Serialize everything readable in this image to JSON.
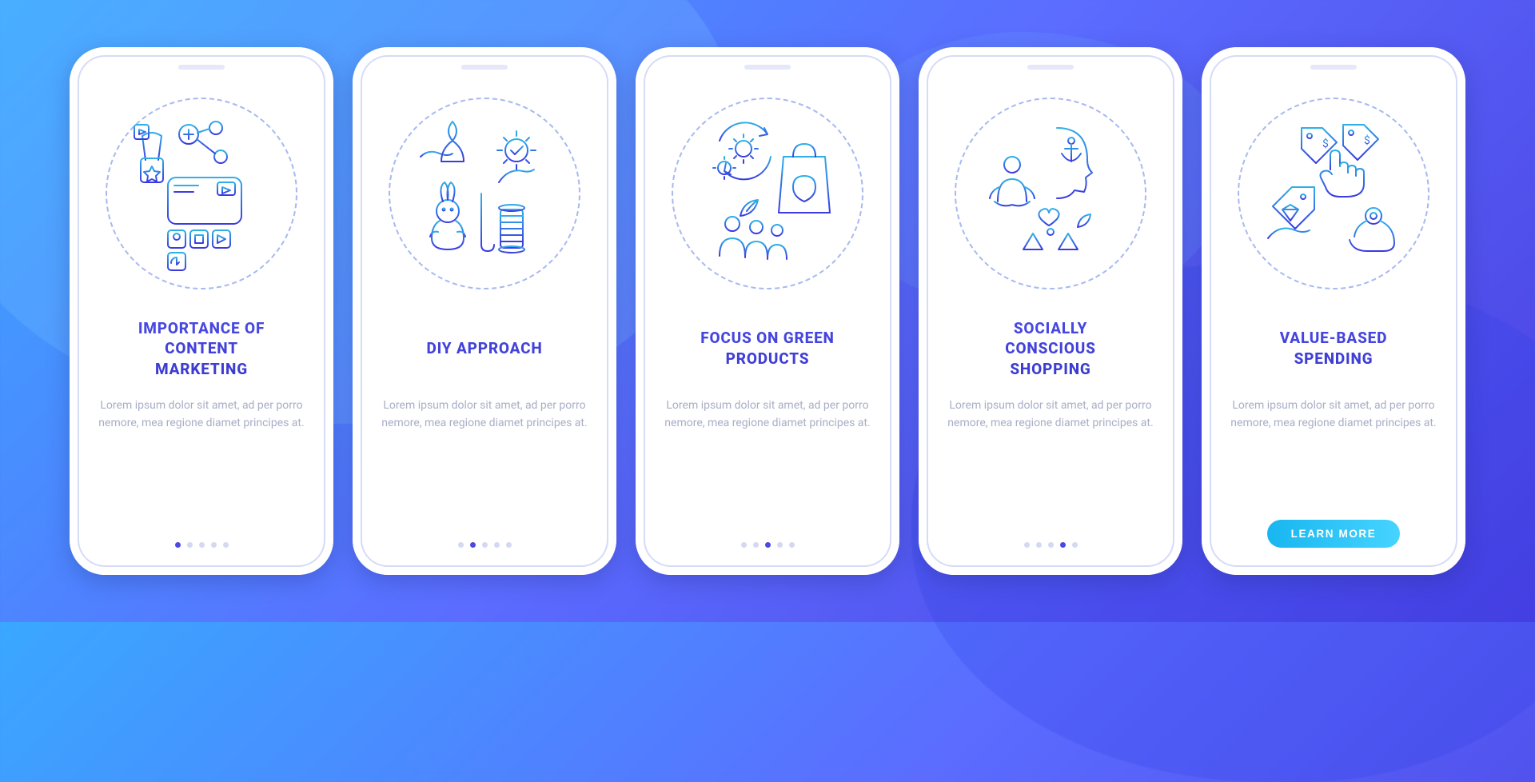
{
  "colors": {
    "gradient_start": "#3AA8FF",
    "gradient_mid": "#5B6CFF",
    "gradient_end": "#4A3FE0",
    "title_color": "#4A4AE6",
    "body_color": "#A9ADC6",
    "cta_start": "#18B6F0",
    "cta_end": "#46D4FF",
    "icon_stroke_top": "#2FB0E8",
    "icon_stroke_bottom": "#3A3AE0"
  },
  "cards": [
    {
      "title": "IMPORTANCE OF\nCONTENT\nMARKETING",
      "body": "Lorem ipsum dolor sit amet, ad per porro nemore, mea regione diamet principes at.",
      "icon": "content-marketing-icon",
      "active_index": 0
    },
    {
      "title": "DIY APPROACH",
      "body": "Lorem ipsum dolor sit amet, ad per porro nemore, mea regione diamet principes at.",
      "icon": "diy-icon",
      "active_index": 1
    },
    {
      "title": "FOCUS ON GREEN\nPRODUCTS",
      "body": "Lorem ipsum dolor sit amet, ad per porro nemore, mea regione diamet principes at.",
      "icon": "green-products-icon",
      "active_index": 2
    },
    {
      "title": "SOCIALLY\nCONSCIOUS\nSHOPPING",
      "body": "Lorem ipsum dolor sit amet, ad per porro nemore, mea regione diamet principes at.",
      "icon": "socially-conscious-icon",
      "active_index": 3
    },
    {
      "title": "VALUE-BASED\nSPENDING",
      "body": "Lorem ipsum dolor sit amet, ad per porro nemore, mea regione diamet principes at.",
      "icon": "value-spending-icon",
      "active_index": 4,
      "cta_label": "LEARN MORE"
    }
  ],
  "dot_count": 5
}
